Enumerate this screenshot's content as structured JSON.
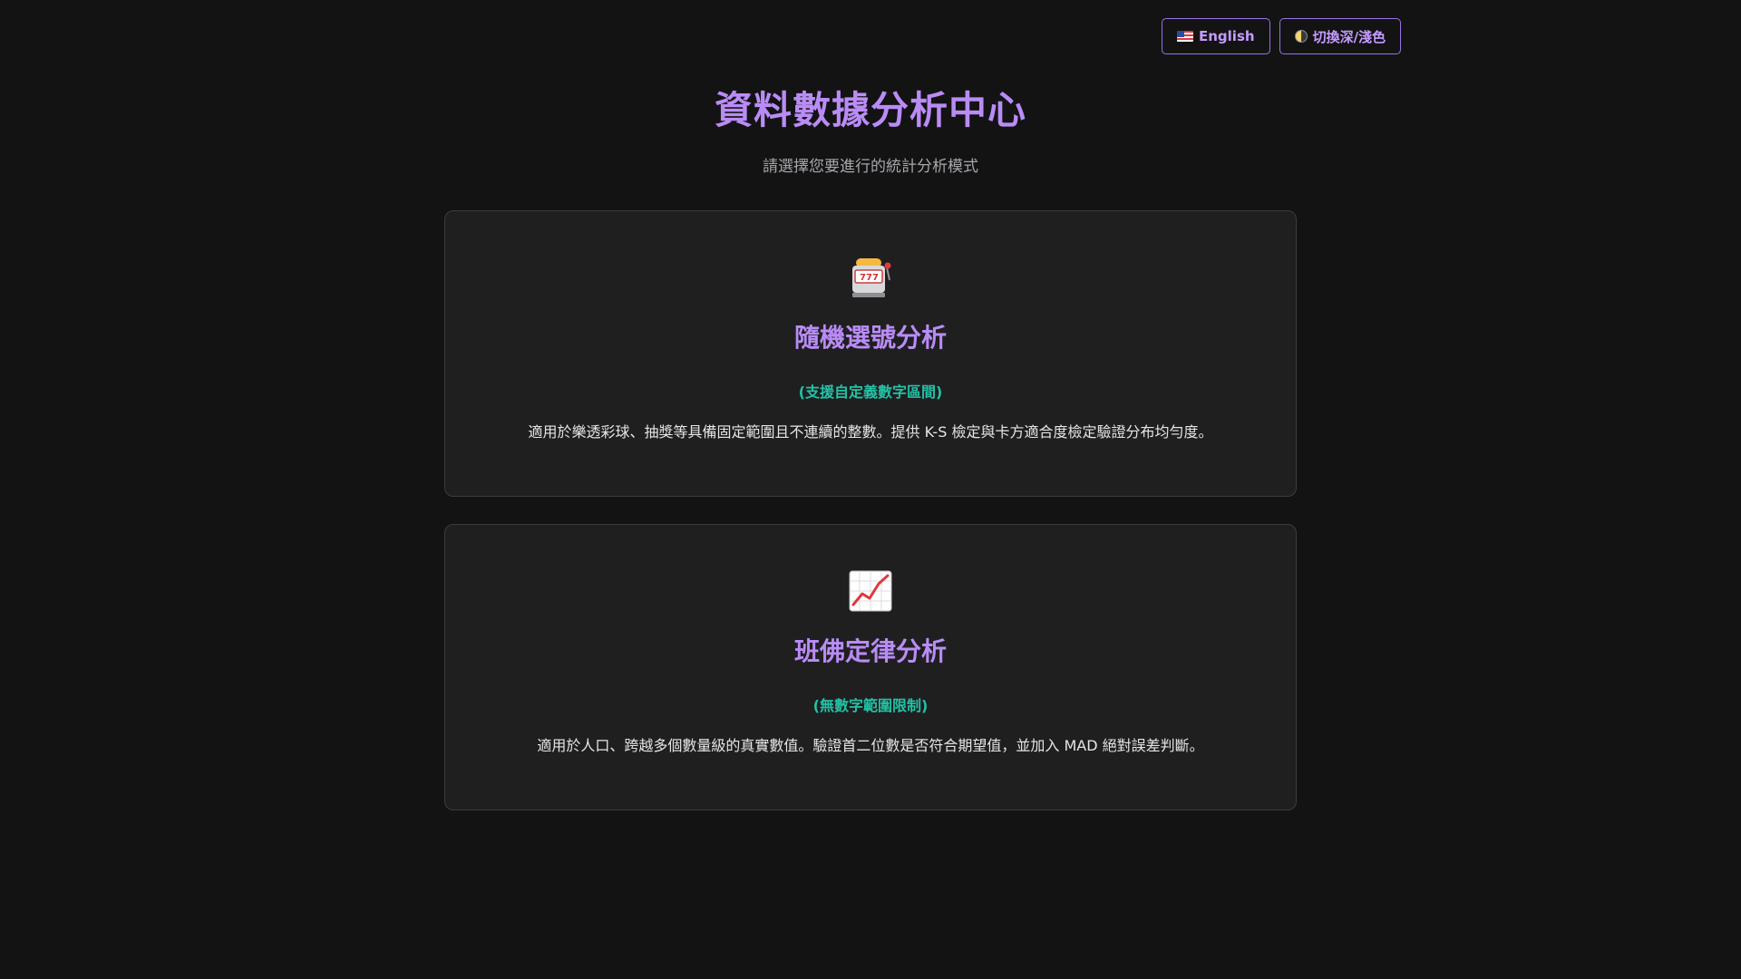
{
  "toolbar": {
    "language_label": "English",
    "theme_label": "切換深/淺色"
  },
  "header": {
    "title": "資料數據分析中心",
    "subtitle": "請選擇您要進行的統計分析模式"
  },
  "cards": [
    {
      "icon": "slot-machine-icon",
      "title": "隨機選號分析",
      "tag": "(支援自定義數字區間)",
      "description": "適用於樂透彩球、抽獎等具備固定範圍且不連續的整數。提供 K-S 檢定與卡方適合度檢定驗證分布均勻度。"
    },
    {
      "icon": "chart-increasing-icon",
      "title": "班佛定律分析",
      "tag": "(無數字範圍限制)",
      "description": "適用於人口、跨越多個數量級的真實數值。驗證首二位數是否符合期望值，並加入 MAD 絕對誤差判斷。"
    }
  ],
  "colors": {
    "background": "#131314",
    "accent_purple": "#b98cf5",
    "accent_teal": "#22c2a6",
    "card_background": "#1f1f20"
  }
}
